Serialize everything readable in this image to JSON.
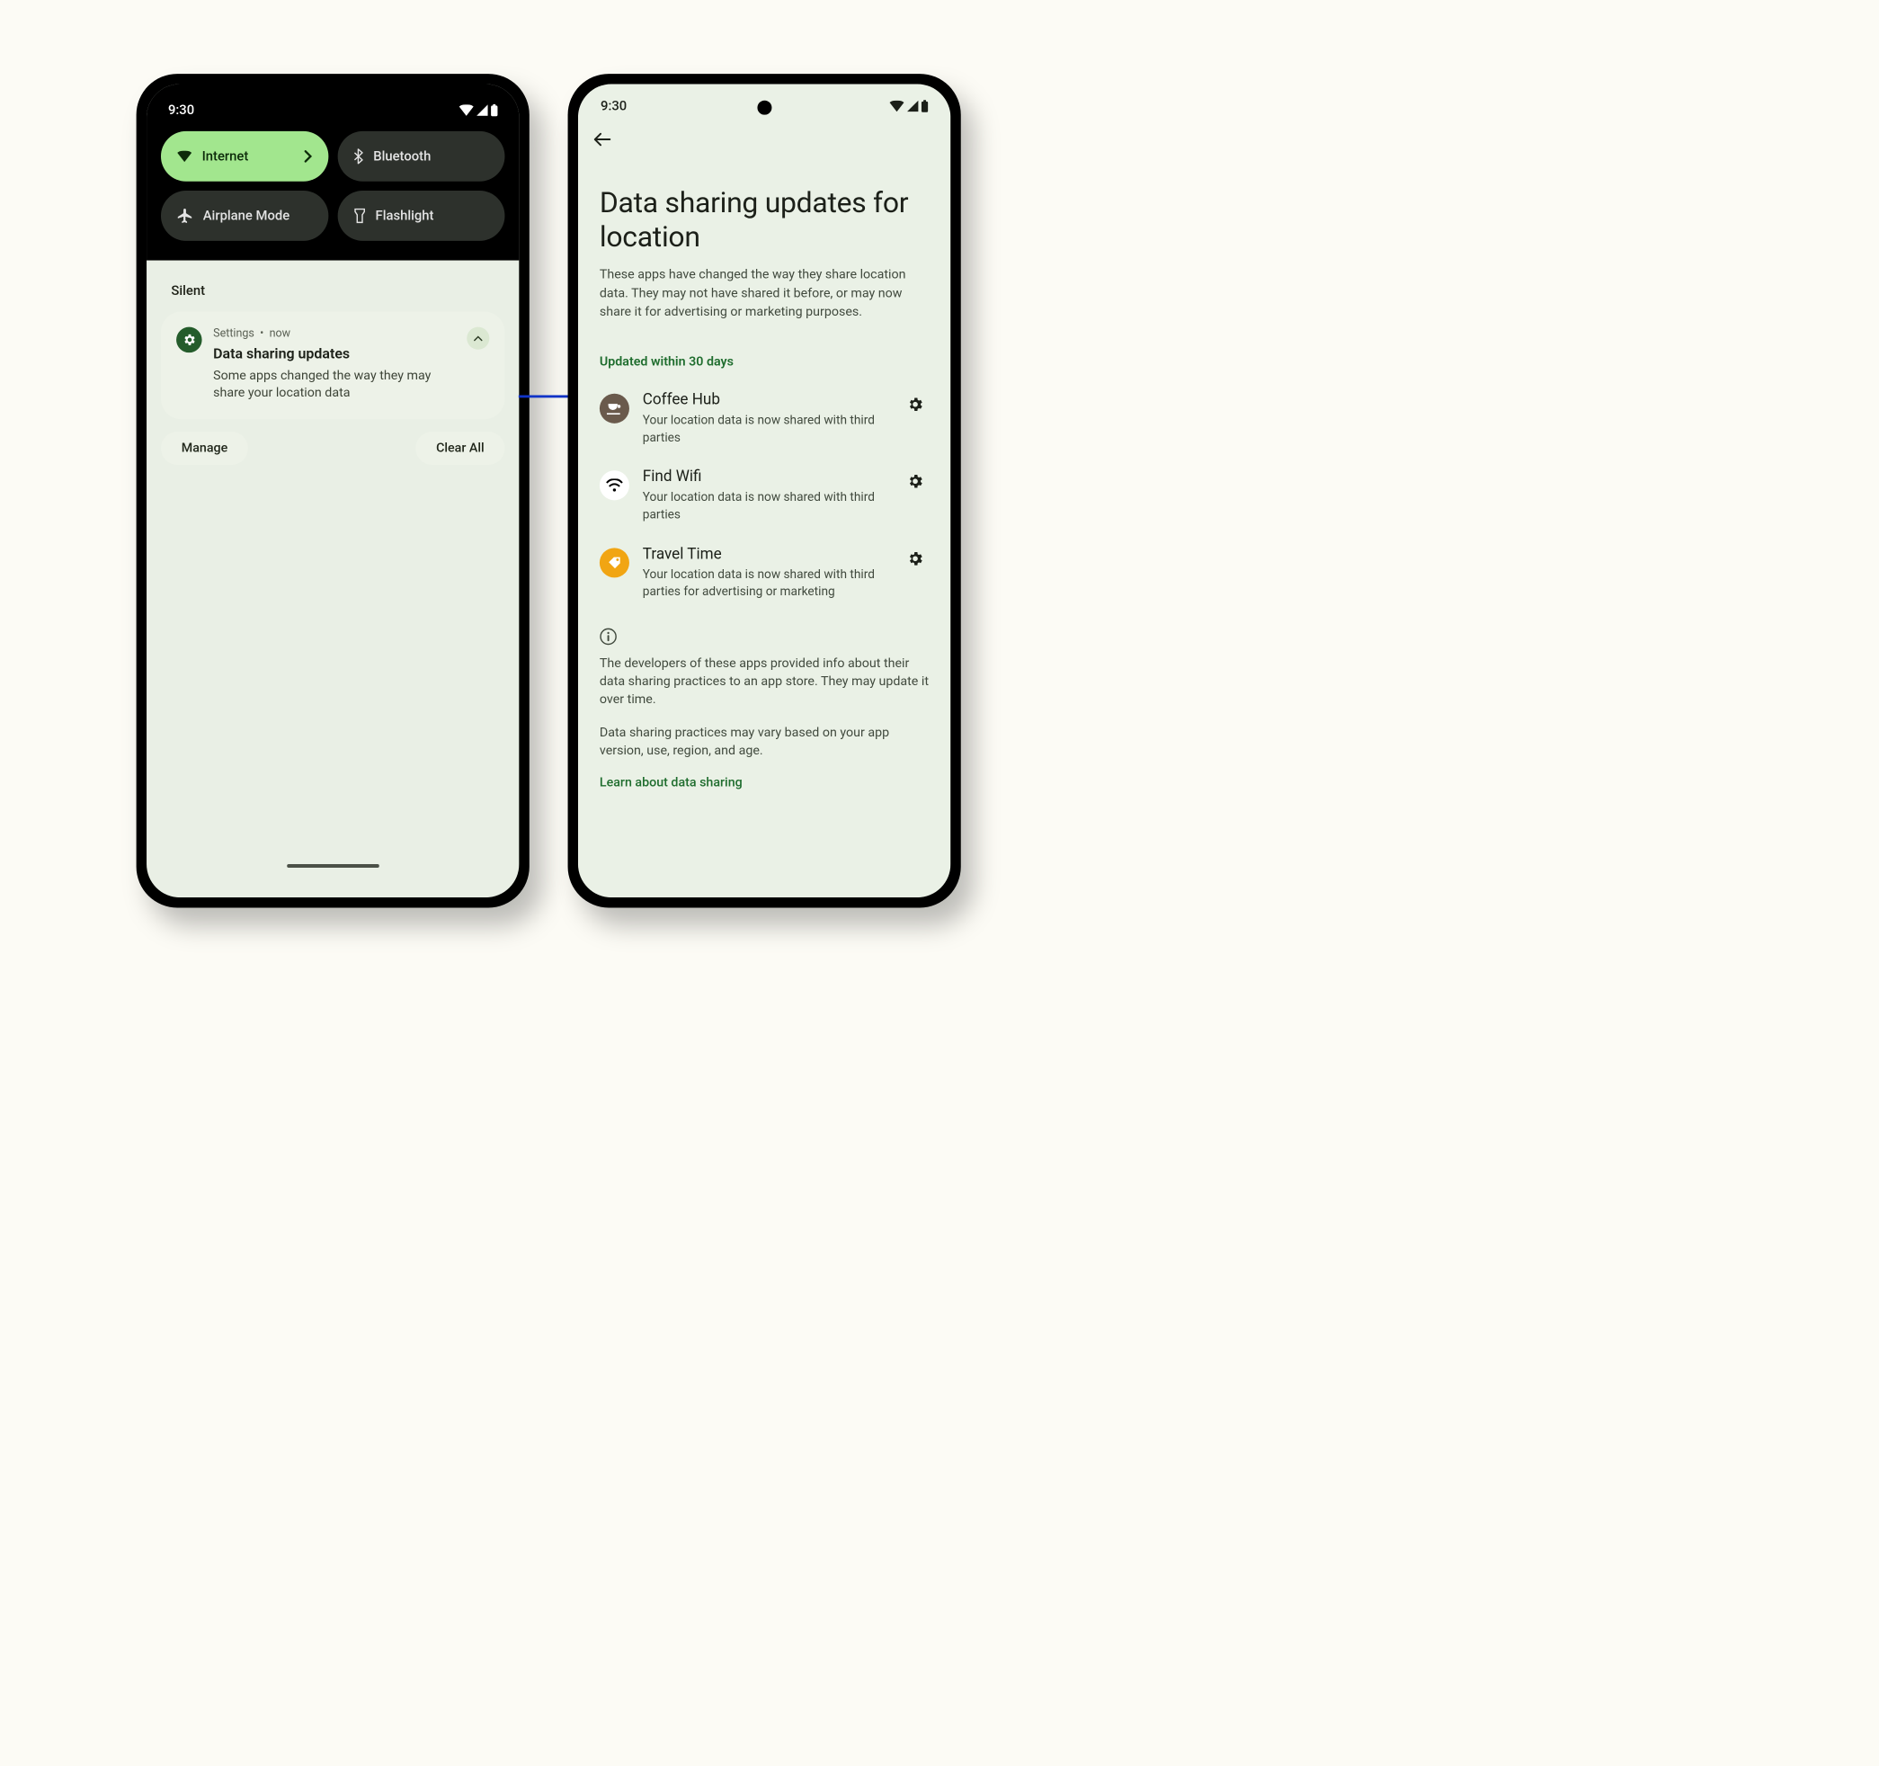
{
  "status_time": "9:30",
  "left": {
    "qs": {
      "internet": "Internet",
      "bluetooth": "Bluetooth",
      "airplane": "Airplane Mode",
      "flashlight": "Flashlight"
    },
    "section_silent": "Silent",
    "notif": {
      "app": "Settings",
      "sep": "•",
      "time": "now",
      "title": "Data sharing updates",
      "text": "Some apps changed the way they may share your location data"
    },
    "manage": "Manage",
    "clear_all": "Clear All"
  },
  "right": {
    "title": "Data sharing updates for location",
    "desc": "These apps have changed the way they share location data. They may not have shared it before, or may now share it for advertising or marketing purposes.",
    "section": "Updated within 30 days",
    "apps": [
      {
        "name": "Coffee Hub",
        "sub": "Your location data is now shared with third parties"
      },
      {
        "name": "Find Wifi",
        "sub": "Your location data is now shared with third parties"
      },
      {
        "name": "Travel Time",
        "sub": "Your location data is now shared with third parties for advertising or marketing"
      }
    ],
    "info1": "The developers of these apps provided info about their data sharing practices to an app store. They may update it over time.",
    "info2": "Data sharing practices may vary based on your app version, use, region, and age.",
    "learn": "Learn about data sharing"
  }
}
